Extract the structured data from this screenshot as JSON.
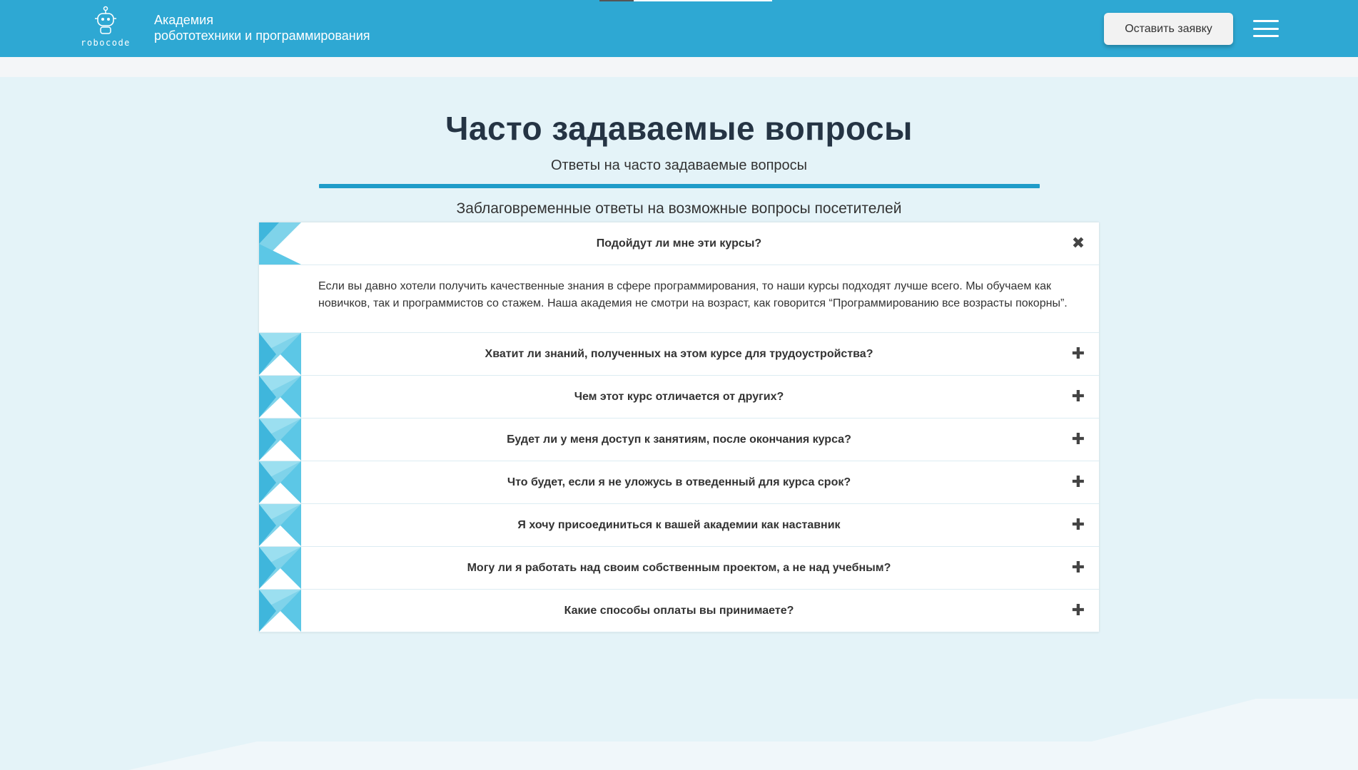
{
  "header": {
    "logo_text": "robocode",
    "brand_line1": "Академия",
    "brand_line2": "робототехники и программирования",
    "cta_label": "Оставить заявку",
    "menu_icon": "hamburger-icon"
  },
  "colors": {
    "header_bg": "#2ea8d3",
    "page_bg": "#e4f3f8",
    "accent": "#1f9cc9",
    "title_text": "#253444"
  },
  "main": {
    "title": "Часто задаваемые вопросы",
    "subtitle": "Ответы на часто задаваемые вопросы",
    "caption": "Заблаговременные ответы на возможные вопросы посетителей"
  },
  "faq": {
    "items": [
      {
        "question": "Подойдут ли мне эти курсы?",
        "expanded": true,
        "toggle_icon": "close-icon",
        "toggle_glyph": "✖",
        "answer": "Если вы давно хотели получить качественные знания в сфере программирования, то наши курсы подходят лучше всего. Мы обучаем как новичков, так и программистов со стажем. Наша академия не смотри на возраст, как говорится “Программированию все возрасты покорны”."
      },
      {
        "question": "Хватит ли знаний, полученных на этом курсе для трудоустройства?",
        "expanded": false,
        "toggle_icon": "plus-icon",
        "toggle_glyph": "✚"
      },
      {
        "question": "Чем этот курс отличается от других?",
        "expanded": false,
        "toggle_icon": "plus-icon",
        "toggle_glyph": "✚"
      },
      {
        "question": "Будет ли у меня доступ к занятиям, после окончания курса?",
        "expanded": false,
        "toggle_icon": "plus-icon",
        "toggle_glyph": "✚"
      },
      {
        "question": "Что будет, если я не уложусь в отведенный для курса срок?",
        "expanded": false,
        "toggle_icon": "plus-icon",
        "toggle_glyph": "✚"
      },
      {
        "question": "Я хочу присоединиться к вашей академии как наставник",
        "expanded": false,
        "toggle_icon": "plus-icon",
        "toggle_glyph": "✚"
      },
      {
        "question": "Могу ли я работать над своим собственным проектом, а не над учебным?",
        "expanded": false,
        "toggle_icon": "plus-icon",
        "toggle_glyph": "✚"
      },
      {
        "question": "Какие способы оплаты вы принимаете?",
        "expanded": false,
        "toggle_icon": "plus-icon",
        "toggle_glyph": "✚"
      }
    ]
  }
}
